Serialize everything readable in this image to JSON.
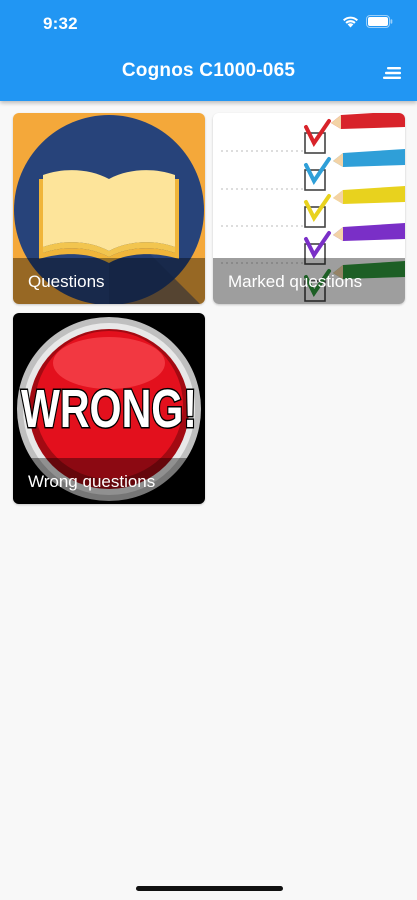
{
  "status_bar": {
    "time": "9:32",
    "icons": [
      "wifi-icon",
      "battery-icon"
    ]
  },
  "app_bar": {
    "title": "Cognos C1000-065",
    "menu_icon": "menu-icon",
    "background_color": "#2196f3"
  },
  "tiles": [
    {
      "label": "Questions",
      "image": "open-book-image",
      "background_color": "#f4a83a"
    },
    {
      "label": "Marked questions",
      "image": "checklist-pencils-image",
      "background_color": "#ffffff"
    },
    {
      "label": "Wrong questions",
      "image": "wrong-button-image",
      "background_color": "#000000"
    }
  ],
  "wrong_image_text": "WRONG!"
}
